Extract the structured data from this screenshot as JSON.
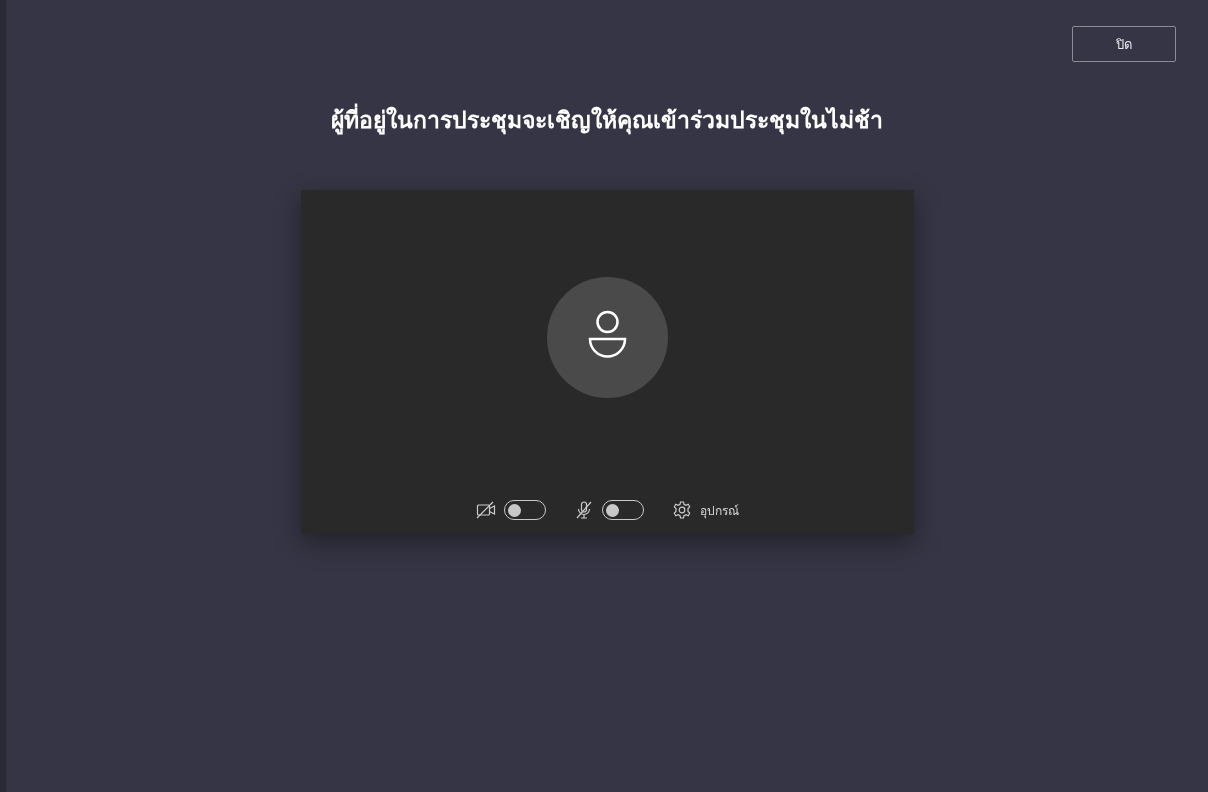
{
  "close_button": {
    "label": "ปิด"
  },
  "title": "ผู้ที่อยู่ในการประชุมจะเชิญให้คุณเข้าร่วมประชุมในไม่ช้า",
  "controls": {
    "camera": {
      "on": false
    },
    "microphone": {
      "on": false
    },
    "devices": {
      "label": "อุปกรณ์"
    }
  }
}
